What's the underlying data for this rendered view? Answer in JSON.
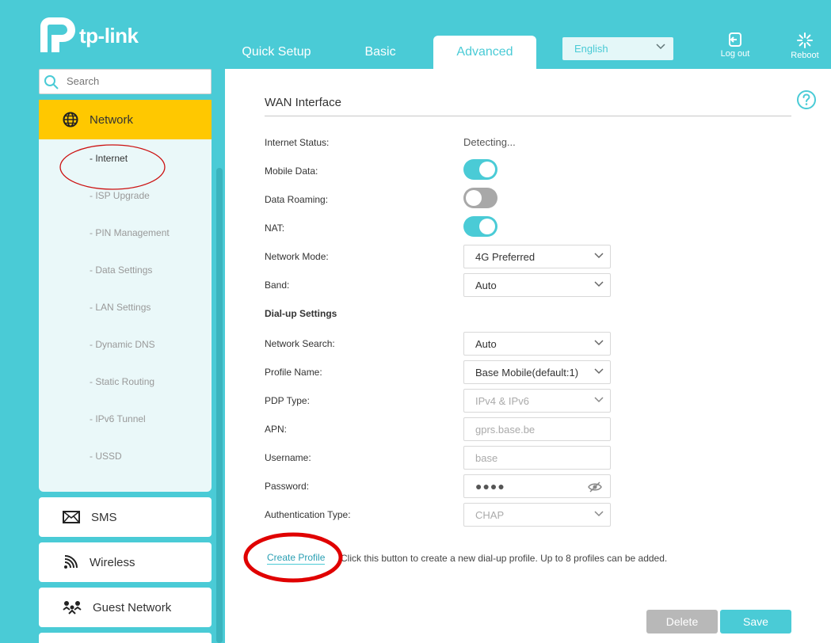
{
  "brand": {
    "name": "tp-link"
  },
  "header": {
    "tabs": [
      {
        "label": "Quick Setup"
      },
      {
        "label": "Basic"
      },
      {
        "label": "Advanced"
      }
    ],
    "language": "English",
    "logout_label": "Log out",
    "reboot_label": "Reboot"
  },
  "sidebar": {
    "search_placeholder": "Search",
    "network": {
      "label": "Network",
      "items": [
        {
          "label": "- Internet"
        },
        {
          "label": "- ISP Upgrade"
        },
        {
          "label": "- PIN Management"
        },
        {
          "label": "- Data Settings"
        },
        {
          "label": "- LAN Settings"
        },
        {
          "label": "- Dynamic DNS"
        },
        {
          "label": "- Static Routing"
        },
        {
          "label": "- IPv6 Tunnel"
        },
        {
          "label": "- USSD"
        }
      ]
    },
    "sms_label": "SMS",
    "wireless_label": "Wireless",
    "guest_label": "Guest Network"
  },
  "main": {
    "title": "WAN Interface",
    "internet_status": {
      "label": "Internet Status:",
      "value": "Detecting..."
    },
    "mobile_data": {
      "label": "Mobile Data:",
      "on": true
    },
    "data_roaming": {
      "label": "Data Roaming:",
      "on": false
    },
    "nat": {
      "label": "NAT:",
      "on": true
    },
    "network_mode": {
      "label": "Network Mode:",
      "value": "4G Preferred"
    },
    "band": {
      "label": "Band:",
      "value": "Auto"
    },
    "dialup_title": "Dial-up Settings",
    "network_search": {
      "label": "Network Search:",
      "value": "Auto"
    },
    "profile_name": {
      "label": "Profile Name:",
      "value": "Base Mobile(default:1)"
    },
    "pdp_type": {
      "label": "PDP Type:",
      "value": "IPv4 & IPv6"
    },
    "apn": {
      "label": "APN:",
      "value": "gprs.base.be"
    },
    "username": {
      "label": "Username:",
      "value": "base"
    },
    "password": {
      "label": "Password:",
      "value": "●●●●"
    },
    "auth_type": {
      "label": "Authentication Type:",
      "value": "CHAP"
    },
    "create_profile_label": "Create Profile",
    "create_profile_hint": "Click this button to create a new dial-up profile. Up to 8 profiles can be added.",
    "delete_label": "Delete",
    "save_label": "Save"
  },
  "colors": {
    "accent": "#4acbd6",
    "highlight": "#ffc800",
    "annotation": "#e00000"
  }
}
